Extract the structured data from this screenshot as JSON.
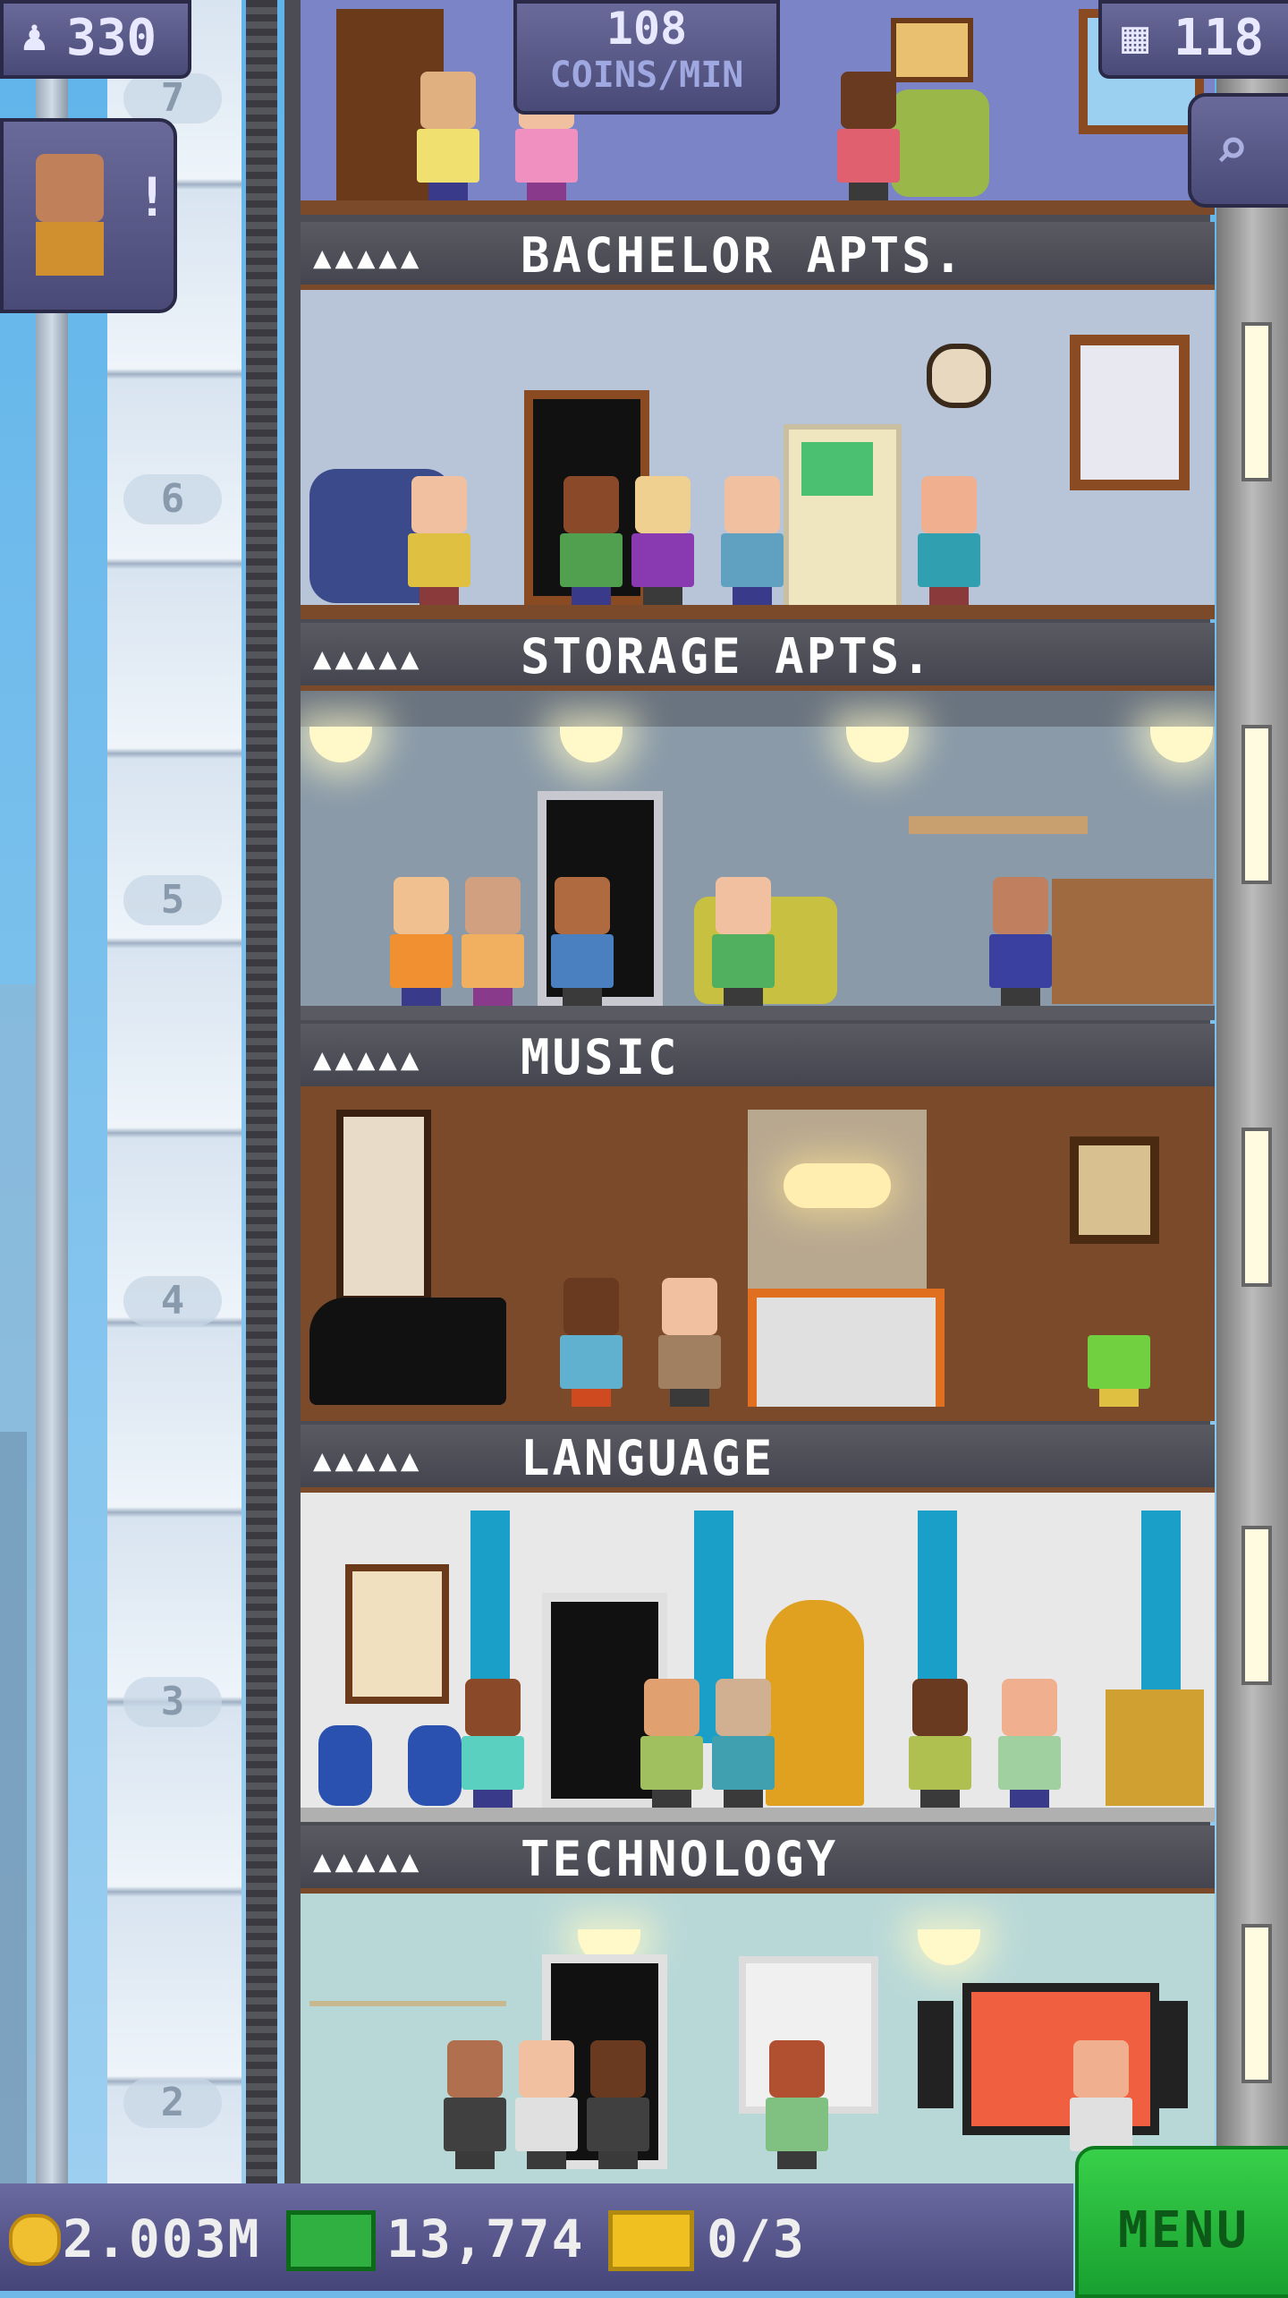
{
  "hud": {
    "population": "330",
    "coins_rate_value": "108",
    "coins_rate_unit": "COINS/MIN",
    "floors_count": "118",
    "coins": "2.003M",
    "bux": "13,774",
    "tickets": "0/3",
    "menu_label": "MENU"
  },
  "icons": {
    "population": "people-icon",
    "floors": "building-icon",
    "search": "magnifier-icon",
    "coin": "coin-icon",
    "bux": "bux-icon",
    "ticket": "ticket-icon"
  },
  "elevator": {
    "floor_numbers": [
      "7",
      "6",
      "5",
      "4",
      "3",
      "2"
    ]
  },
  "floors": [
    {
      "name": "BACHELOR APTS.",
      "pips": "▲▲▲▲▲"
    },
    {
      "name": "STORAGE APTS.",
      "pips": "▲▲▲▲▲"
    },
    {
      "name": "MUSIC",
      "pips": "▲▲▲▲▲"
    },
    {
      "name": "LANGUAGE",
      "pips": "▲▲▲▲▲"
    },
    {
      "name": "TECHNOLOGY",
      "pips": "▲▲▲▲▲"
    }
  ]
}
